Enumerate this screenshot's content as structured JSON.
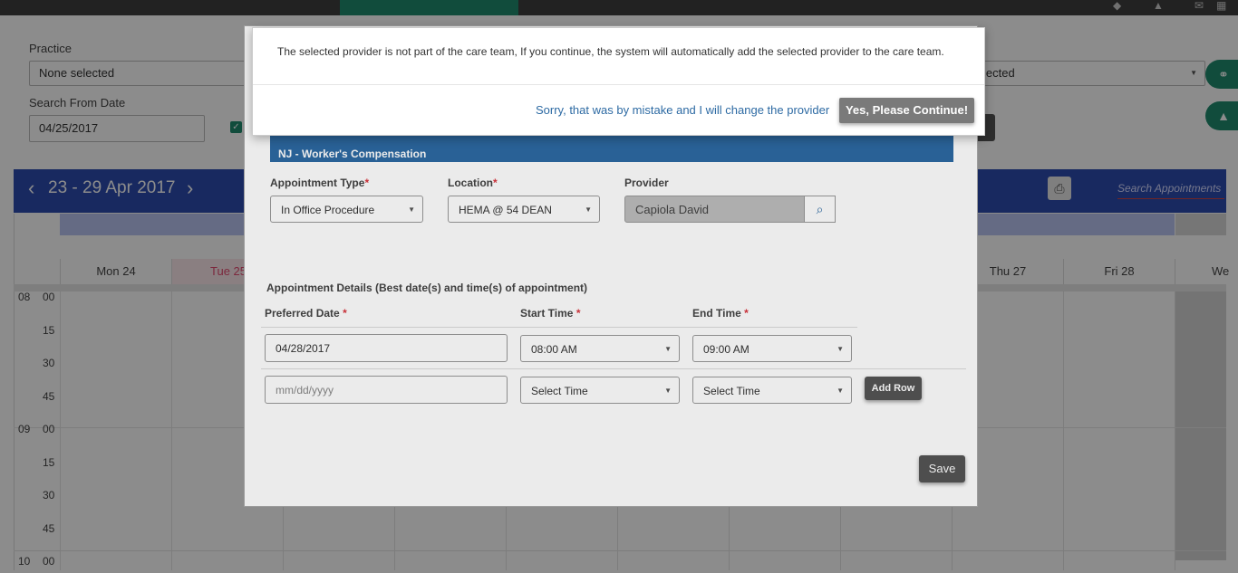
{
  "filters": {
    "practice_label": "Practice",
    "practice_value": "None selected",
    "right_select_value": "lected",
    "search_from_label": "Search From Date",
    "search_from_value": "04/25/2017"
  },
  "calendar": {
    "range_title": "23 - 29 Apr 2017",
    "prev_icon": "chevron-left-icon",
    "next_icon": "chevron-right-icon",
    "search_placeholder": "Search Appointments",
    "days": [
      {
        "label": "Mon 24"
      },
      {
        "label": "Tue 25",
        "today": true
      },
      {
        "label": "Thu 27"
      },
      {
        "label": "Fri 28"
      },
      {
        "label": "We"
      }
    ],
    "times": [
      {
        "hour": "08",
        "min": "00"
      },
      {
        "hour": "",
        "min": "15"
      },
      {
        "hour": "",
        "min": "30"
      },
      {
        "hour": "",
        "min": "45"
      },
      {
        "hour": "09",
        "min": "00"
      },
      {
        "hour": "",
        "min": "15"
      },
      {
        "hour": "",
        "min": "30"
      },
      {
        "hour": "",
        "min": "45"
      },
      {
        "hour": "10",
        "min": "00"
      }
    ]
  },
  "modal": {
    "plan_name": "NJ - Worker's Compensation",
    "appointment_type_label": "Appointment Type",
    "appointment_type_value": "In Office Procedure",
    "location_label": "Location",
    "location_value": "HEMA @ 54 DEAN",
    "provider_label": "Provider",
    "provider_value": "Capiola David",
    "details_heading": "Appointment Details (Best date(s) and time(s) of appointment)",
    "preferred_date_label": "Preferred Date",
    "start_time_label": "Start Time",
    "end_time_label": "End Time",
    "row1": {
      "date": "04/28/2017",
      "start": "08:00 AM",
      "end": "09:00 AM"
    },
    "row2": {
      "date_placeholder": "mm/dd/yyyy",
      "start": "Select Time",
      "end": "Select Time"
    },
    "add_row_label": "Add Row",
    "save_label": "Save",
    "required_mark": "*"
  },
  "confirm": {
    "message": "The selected provider is not part of the care team, If you continue, the system will automatically add the selected provider to the care team.",
    "cancel_label": "Sorry, that was by mistake and I will change the provider",
    "continue_label": "Yes, Please Continue!"
  }
}
